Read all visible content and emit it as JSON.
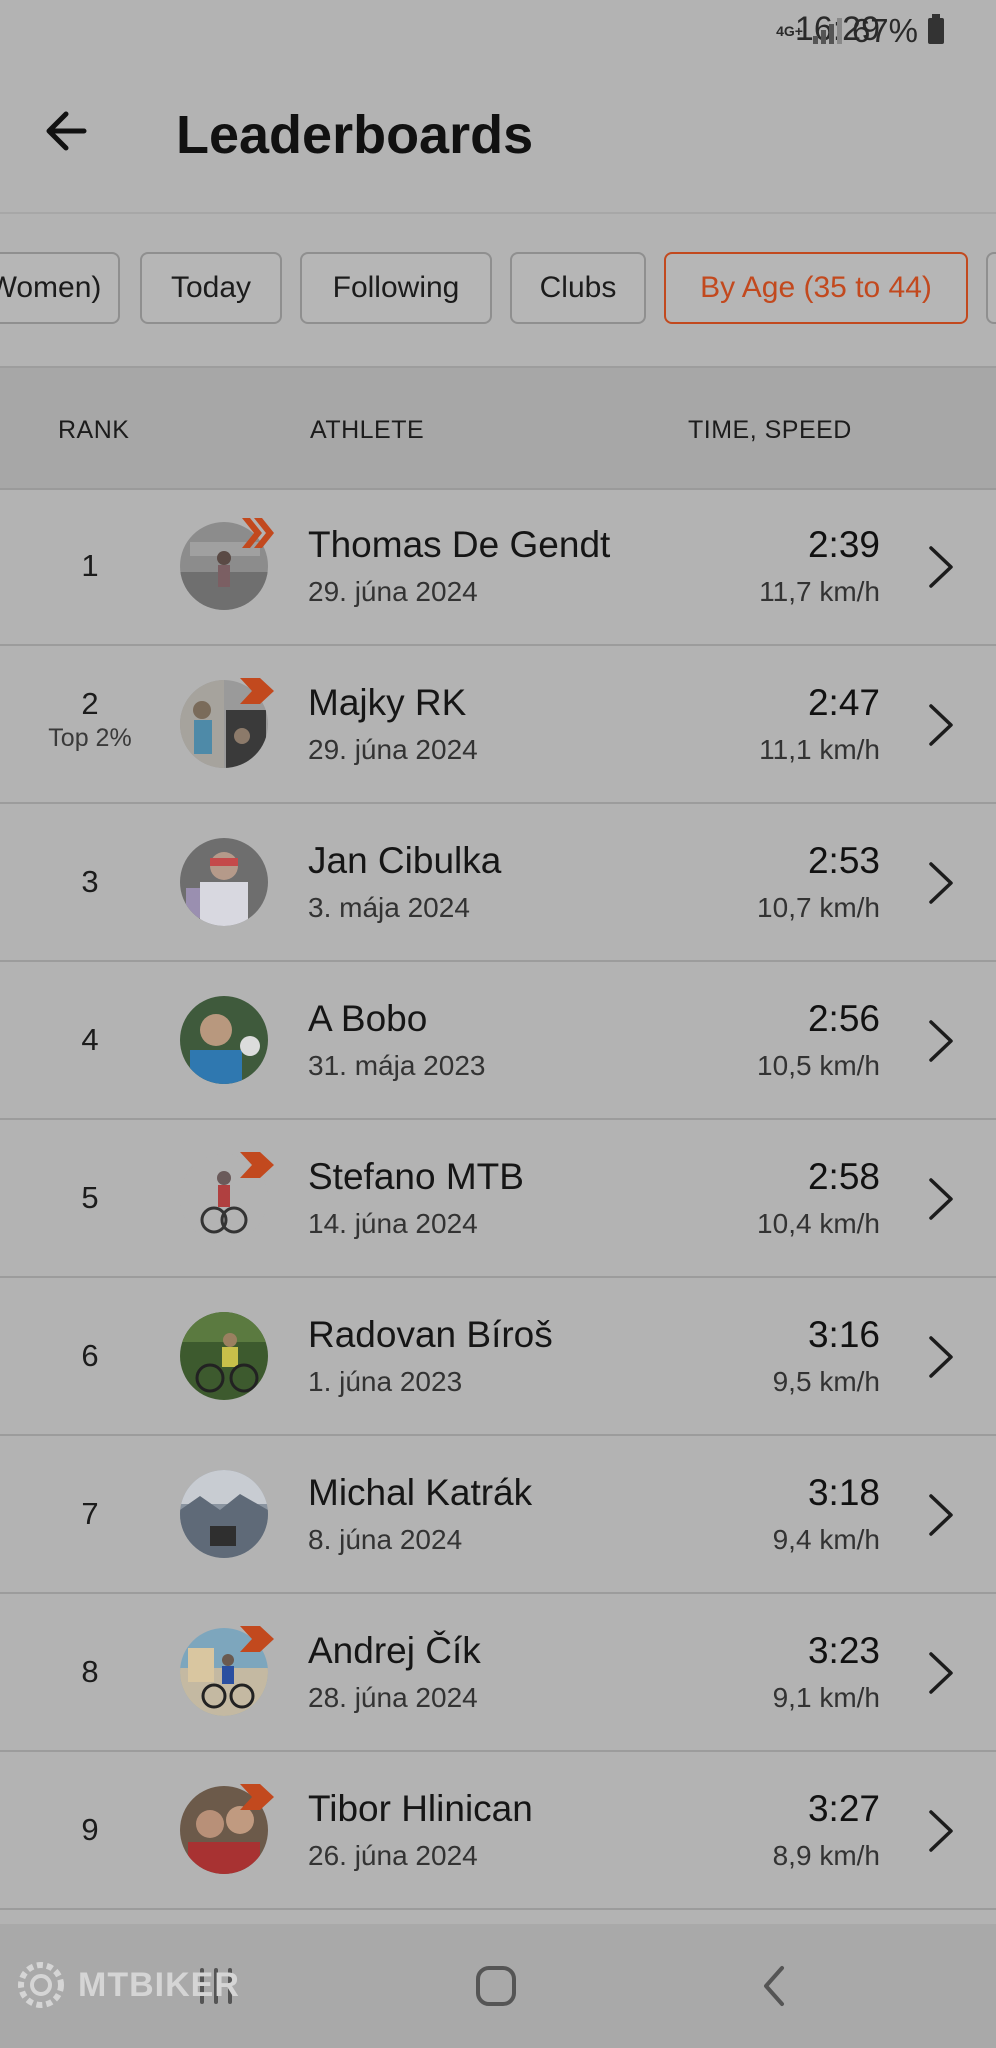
{
  "status_bar": {
    "time": "16:29",
    "network": "4G+",
    "battery_percent": "67%"
  },
  "header": {
    "title": "Leaderboards"
  },
  "filters": [
    {
      "label": "Women)",
      "active": false
    },
    {
      "label": "Today",
      "active": false
    },
    {
      "label": "Following",
      "active": false
    },
    {
      "label": "Clubs",
      "active": false
    },
    {
      "label": "By Age (35 to 44)",
      "active": true
    }
  ],
  "table_header": {
    "rank": "RANK",
    "athlete": "ATHLETE",
    "time_speed": "TIME, SPEED"
  },
  "rows": [
    {
      "rank": "1",
      "percentile": "",
      "name": "Thomas De Gendt",
      "date": "29. júna 2024",
      "time": "2:39",
      "speed": "11,7 km/h",
      "badge": "double-chevron-subscriber-badge"
    },
    {
      "rank": "2",
      "percentile": "Top 2%",
      "name": "Majky RK",
      "date": "29. júna 2024",
      "time": "2:47",
      "speed": "11,1 km/h",
      "badge": "subscriber-badge"
    },
    {
      "rank": "3",
      "percentile": "",
      "name": "Jan Cibulka",
      "date": "3. mája 2024",
      "time": "2:53",
      "speed": "10,7 km/h",
      "badge": ""
    },
    {
      "rank": "4",
      "percentile": "",
      "name": "A Bobo",
      "date": "31. mája 2023",
      "time": "2:56",
      "speed": "10,5 km/h",
      "badge": ""
    },
    {
      "rank": "5",
      "percentile": "",
      "name": "Stefano MTB",
      "date": "14. júna 2024",
      "time": "2:58",
      "speed": "10,4 km/h",
      "badge": "subscriber-badge"
    },
    {
      "rank": "6",
      "percentile": "",
      "name": "Radovan Bíroš",
      "date": "1. júna 2023",
      "time": "3:16",
      "speed": "9,5 km/h",
      "badge": ""
    },
    {
      "rank": "7",
      "percentile": "",
      "name": "Michal Katrák",
      "date": "8. júna 2024",
      "time": "3:18",
      "speed": "9,4 km/h",
      "badge": ""
    },
    {
      "rank": "8",
      "percentile": "",
      "name": "Andrej Čík",
      "date": "28. júna 2024",
      "time": "3:23",
      "speed": "9,1 km/h",
      "badge": "subscriber-badge"
    },
    {
      "rank": "9",
      "percentile": "",
      "name": "Tibor Hlinican",
      "date": "26. júna 2024",
      "time": "3:27",
      "speed": "8,9 km/h",
      "badge": "subscriber-badge"
    }
  ],
  "navigation": {
    "recents": "recents-icon",
    "home": "home-icon",
    "back": "back-icon"
  },
  "watermark": "MTBIKER",
  "colors": {
    "accent": "#c2491e",
    "background": "#b3b3b3"
  }
}
